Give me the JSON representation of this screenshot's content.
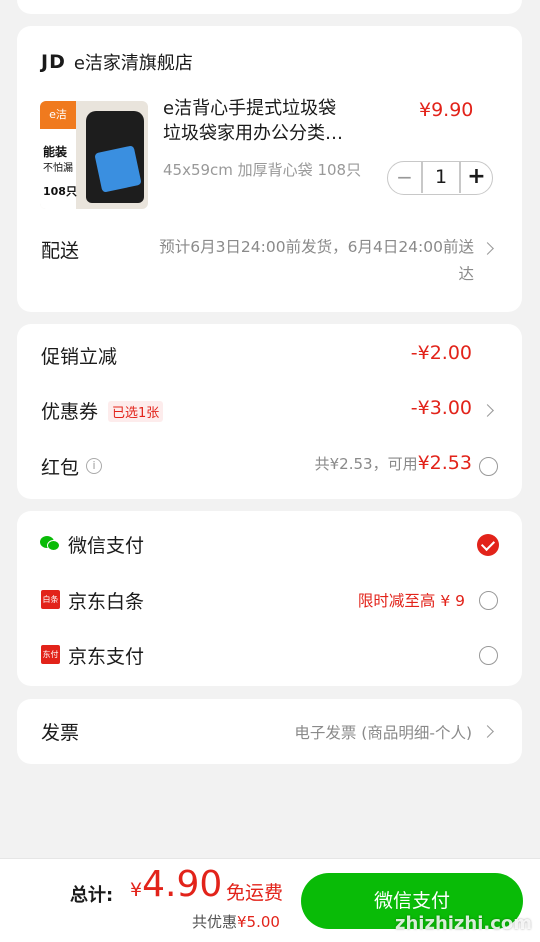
{
  "store": {
    "brand_logo": "JD",
    "name": "e洁家清旗舰店"
  },
  "product": {
    "image_tag": "e洁",
    "image_text1": "能装",
    "image_text2": "不怕漏",
    "image_count": "108只",
    "title_line1": "e洁背心手提式垃圾袋",
    "title_line2": "垃圾袋家用办公分类…",
    "spec": "45x59cm 加厚背心袋 108只",
    "price": "¥9.90",
    "quantity": "1",
    "minus": "−",
    "plus": "+"
  },
  "delivery": {
    "label": "配送",
    "line1": "预计6月3日24:00前发货，6月4日24:00前送",
    "line2": "达"
  },
  "discounts": {
    "promo_label": "促销立减",
    "promo_value": "-¥2.00",
    "coupon_label": "优惠券",
    "coupon_badge": "已选1张",
    "coupon_value": "-¥3.00",
    "redpacket_label": "红包",
    "redpacket_info_icon": "i",
    "redpacket_text": "共¥2.53，可用",
    "redpacket_value": "¥2.53"
  },
  "payment": {
    "wechat": {
      "label": "微信支付",
      "selected": true
    },
    "baitiao": {
      "label": "京东白条",
      "promo": "限时减至高 ¥ 9",
      "icon_text": "白条"
    },
    "jdpay": {
      "label": "京东支付",
      "icon_text": "东付"
    }
  },
  "invoice": {
    "label": "发票",
    "value": "电子发票 (商品明细-个人)"
  },
  "footer": {
    "total_label": "总计:",
    "currency": "¥",
    "total_amount": "4.90",
    "shipping": "免运费",
    "discount_label": "共优惠",
    "discount_value": "¥5.00",
    "pay_button": "微信支付"
  },
  "watermark": "zhizhizhi.com",
  "colors": {
    "accent_red": "#e2231a",
    "wechat_green": "#09bb07"
  }
}
